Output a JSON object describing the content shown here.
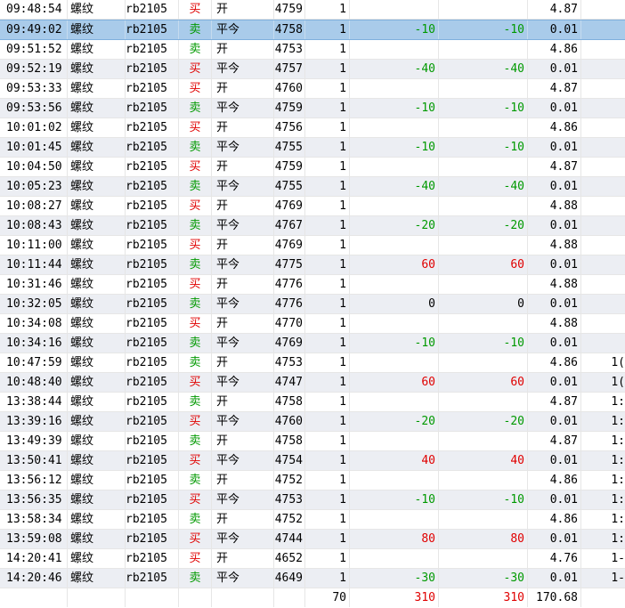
{
  "colors": {
    "buy": "#e00000",
    "sell": "#009900",
    "selected_row": "#a9cbea",
    "alt_row": "#eceef3"
  },
  "selected_index": 1,
  "rows": [
    {
      "time": "09:48:54",
      "name": "螺纹",
      "code": "rb2105",
      "dir": "买",
      "oc": "开",
      "price": "4759",
      "qty": "1",
      "pnl": "",
      "pnl2": "",
      "fee": "4.87",
      "last": "",
      "dirc": "buy",
      "pc": ""
    },
    {
      "time": "09:49:02",
      "name": "螺纹",
      "code": "rb2105",
      "dir": "卖",
      "oc": "平今",
      "price": "4758",
      "qty": "1",
      "pnl": "-10",
      "pnl2": "-10",
      "fee": "0.01",
      "last": "",
      "dirc": "sell",
      "pc": "neg"
    },
    {
      "time": "09:51:52",
      "name": "螺纹",
      "code": "rb2105",
      "dir": "卖",
      "oc": "开",
      "price": "4753",
      "qty": "1",
      "pnl": "",
      "pnl2": "",
      "fee": "4.86",
      "last": "",
      "dirc": "sell",
      "pc": ""
    },
    {
      "time": "09:52:19",
      "name": "螺纹",
      "code": "rb2105",
      "dir": "买",
      "oc": "平今",
      "price": "4757",
      "qty": "1",
      "pnl": "-40",
      "pnl2": "-40",
      "fee": "0.01",
      "last": "",
      "dirc": "buy",
      "pc": "neg"
    },
    {
      "time": "09:53:33",
      "name": "螺纹",
      "code": "rb2105",
      "dir": "买",
      "oc": "开",
      "price": "4760",
      "qty": "1",
      "pnl": "",
      "pnl2": "",
      "fee": "4.87",
      "last": "",
      "dirc": "buy",
      "pc": ""
    },
    {
      "time": "09:53:56",
      "name": "螺纹",
      "code": "rb2105",
      "dir": "卖",
      "oc": "平今",
      "price": "4759",
      "qty": "1",
      "pnl": "-10",
      "pnl2": "-10",
      "fee": "0.01",
      "last": "",
      "dirc": "sell",
      "pc": "neg"
    },
    {
      "time": "10:01:02",
      "name": "螺纹",
      "code": "rb2105",
      "dir": "买",
      "oc": "开",
      "price": "4756",
      "qty": "1",
      "pnl": "",
      "pnl2": "",
      "fee": "4.86",
      "last": "",
      "dirc": "buy",
      "pc": ""
    },
    {
      "time": "10:01:45",
      "name": "螺纹",
      "code": "rb2105",
      "dir": "卖",
      "oc": "平今",
      "price": "4755",
      "qty": "1",
      "pnl": "-10",
      "pnl2": "-10",
      "fee": "0.01",
      "last": "",
      "dirc": "sell",
      "pc": "neg"
    },
    {
      "time": "10:04:50",
      "name": "螺纹",
      "code": "rb2105",
      "dir": "买",
      "oc": "开",
      "price": "4759",
      "qty": "1",
      "pnl": "",
      "pnl2": "",
      "fee": "4.87",
      "last": "",
      "dirc": "buy",
      "pc": ""
    },
    {
      "time": "10:05:23",
      "name": "螺纹",
      "code": "rb2105",
      "dir": "卖",
      "oc": "平今",
      "price": "4755",
      "qty": "1",
      "pnl": "-40",
      "pnl2": "-40",
      "fee": "0.01",
      "last": "",
      "dirc": "sell",
      "pc": "neg"
    },
    {
      "time": "10:08:27",
      "name": "螺纹",
      "code": "rb2105",
      "dir": "买",
      "oc": "开",
      "price": "4769",
      "qty": "1",
      "pnl": "",
      "pnl2": "",
      "fee": "4.88",
      "last": "",
      "dirc": "buy",
      "pc": ""
    },
    {
      "time": "10:08:43",
      "name": "螺纹",
      "code": "rb2105",
      "dir": "卖",
      "oc": "平今",
      "price": "4767",
      "qty": "1",
      "pnl": "-20",
      "pnl2": "-20",
      "fee": "0.01",
      "last": "",
      "dirc": "sell",
      "pc": "neg"
    },
    {
      "time": "10:11:00",
      "name": "螺纹",
      "code": "rb2105",
      "dir": "买",
      "oc": "开",
      "price": "4769",
      "qty": "1",
      "pnl": "",
      "pnl2": "",
      "fee": "4.88",
      "last": "",
      "dirc": "buy",
      "pc": ""
    },
    {
      "time": "10:11:44",
      "name": "螺纹",
      "code": "rb2105",
      "dir": "卖",
      "oc": "平今",
      "price": "4775",
      "qty": "1",
      "pnl": "60",
      "pnl2": "60",
      "fee": "0.01",
      "last": "",
      "dirc": "sell",
      "pc": "pos"
    },
    {
      "time": "10:31:46",
      "name": "螺纹",
      "code": "rb2105",
      "dir": "买",
      "oc": "开",
      "price": "4776",
      "qty": "1",
      "pnl": "",
      "pnl2": "",
      "fee": "4.88",
      "last": "",
      "dirc": "buy",
      "pc": ""
    },
    {
      "time": "10:32:05",
      "name": "螺纹",
      "code": "rb2105",
      "dir": "卖",
      "oc": "平今",
      "price": "4776",
      "qty": "1",
      "pnl": "0",
      "pnl2": "0",
      "fee": "0.01",
      "last": "",
      "dirc": "sell",
      "pc": "zero"
    },
    {
      "time": "10:34:08",
      "name": "螺纹",
      "code": "rb2105",
      "dir": "买",
      "oc": "开",
      "price": "4770",
      "qty": "1",
      "pnl": "",
      "pnl2": "",
      "fee": "4.88",
      "last": "",
      "dirc": "buy",
      "pc": ""
    },
    {
      "time": "10:34:16",
      "name": "螺纹",
      "code": "rb2105",
      "dir": "卖",
      "oc": "平今",
      "price": "4769",
      "qty": "1",
      "pnl": "-10",
      "pnl2": "-10",
      "fee": "0.01",
      "last": "",
      "dirc": "sell",
      "pc": "neg"
    },
    {
      "time": "10:47:59",
      "name": "螺纹",
      "code": "rb2105",
      "dir": "卖",
      "oc": "开",
      "price": "4753",
      "qty": "1",
      "pnl": "",
      "pnl2": "",
      "fee": "4.86",
      "last": "1(",
      "dirc": "sell",
      "pc": ""
    },
    {
      "time": "10:48:40",
      "name": "螺纹",
      "code": "rb2105",
      "dir": "买",
      "oc": "平今",
      "price": "4747",
      "qty": "1",
      "pnl": "60",
      "pnl2": "60",
      "fee": "0.01",
      "last": "1(",
      "dirc": "buy",
      "pc": "pos"
    },
    {
      "time": "13:38:44",
      "name": "螺纹",
      "code": "rb2105",
      "dir": "卖",
      "oc": "开",
      "price": "4758",
      "qty": "1",
      "pnl": "",
      "pnl2": "",
      "fee": "4.87",
      "last": "1:",
      "dirc": "sell",
      "pc": ""
    },
    {
      "time": "13:39:16",
      "name": "螺纹",
      "code": "rb2105",
      "dir": "买",
      "oc": "平今",
      "price": "4760",
      "qty": "1",
      "pnl": "-20",
      "pnl2": "-20",
      "fee": "0.01",
      "last": "1:",
      "dirc": "buy",
      "pc": "neg"
    },
    {
      "time": "13:49:39",
      "name": "螺纹",
      "code": "rb2105",
      "dir": "卖",
      "oc": "开",
      "price": "4758",
      "qty": "1",
      "pnl": "",
      "pnl2": "",
      "fee": "4.87",
      "last": "1:",
      "dirc": "sell",
      "pc": ""
    },
    {
      "time": "13:50:41",
      "name": "螺纹",
      "code": "rb2105",
      "dir": "买",
      "oc": "平今",
      "price": "4754",
      "qty": "1",
      "pnl": "40",
      "pnl2": "40",
      "fee": "0.01",
      "last": "1:",
      "dirc": "buy",
      "pc": "pos"
    },
    {
      "time": "13:56:12",
      "name": "螺纹",
      "code": "rb2105",
      "dir": "卖",
      "oc": "开",
      "price": "4752",
      "qty": "1",
      "pnl": "",
      "pnl2": "",
      "fee": "4.86",
      "last": "1:",
      "dirc": "sell",
      "pc": ""
    },
    {
      "time": "13:56:35",
      "name": "螺纹",
      "code": "rb2105",
      "dir": "买",
      "oc": "平今",
      "price": "4753",
      "qty": "1",
      "pnl": "-10",
      "pnl2": "-10",
      "fee": "0.01",
      "last": "1:",
      "dirc": "buy",
      "pc": "neg"
    },
    {
      "time": "13:58:34",
      "name": "螺纹",
      "code": "rb2105",
      "dir": "卖",
      "oc": "开",
      "price": "4752",
      "qty": "1",
      "pnl": "",
      "pnl2": "",
      "fee": "4.86",
      "last": "1:",
      "dirc": "sell",
      "pc": ""
    },
    {
      "time": "13:59:08",
      "name": "螺纹",
      "code": "rb2105",
      "dir": "买",
      "oc": "平今",
      "price": "4744",
      "qty": "1",
      "pnl": "80",
      "pnl2": "80",
      "fee": "0.01",
      "last": "1:",
      "dirc": "buy",
      "pc": "pos"
    },
    {
      "time": "14:20:41",
      "name": "螺纹",
      "code": "rb2105",
      "dir": "买",
      "oc": "开",
      "price": "4652",
      "qty": "1",
      "pnl": "",
      "pnl2": "",
      "fee": "4.76",
      "last": "1-",
      "dirc": "buy",
      "pc": ""
    },
    {
      "time": "14:20:46",
      "name": "螺纹",
      "code": "rb2105",
      "dir": "卖",
      "oc": "平今",
      "price": "4649",
      "qty": "1",
      "pnl": "-30",
      "pnl2": "-30",
      "fee": "0.01",
      "last": "1-",
      "dirc": "sell",
      "pc": "neg"
    }
  ],
  "totals": {
    "qty": "70",
    "pnl": "310",
    "pnl2": "310",
    "fee": "170.68"
  }
}
